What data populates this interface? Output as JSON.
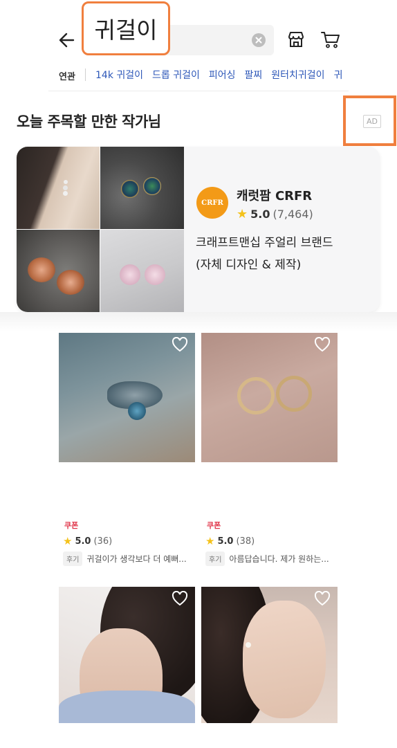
{
  "search": {
    "query": "귀걸이"
  },
  "related": {
    "label": "연관",
    "keywords": [
      "14k 귀걸이",
      "드롭 귀걸이",
      "피어싱",
      "팔찌",
      "원터치귀걸이",
      "귀"
    ]
  },
  "section": {
    "title": "오늘 주목할 만한 작가님",
    "ad_label": "AD"
  },
  "seller": {
    "logo_text": "CRFR",
    "name": "캐럿팜 CRFR",
    "rating": "5.0",
    "rating_count": "(7,464)",
    "desc_line1": "크래프트맨십 주얼리 브랜드",
    "desc_line2": "(자체 디자인 & 제작)"
  },
  "products": [
    {
      "coupon": "쿠폰",
      "rating": "5.0",
      "count": "(36)",
      "review_tag": "후기",
      "review": "귀걸이가 생각보다 더 예뻐..."
    },
    {
      "coupon": "쿠폰",
      "rating": "5.0",
      "count": "(38)",
      "review_tag": "후기",
      "review": "아름답습니다. 제가 원하는..."
    }
  ],
  "colors": {
    "accent": "#f07f3e",
    "link": "#2d57b8",
    "coupon": "#e0364a",
    "star": "#f4c21b"
  },
  "icons": [
    "back-arrow-icon",
    "clear-icon",
    "store-icon",
    "cart-icon",
    "star-icon",
    "heart-icon"
  ]
}
